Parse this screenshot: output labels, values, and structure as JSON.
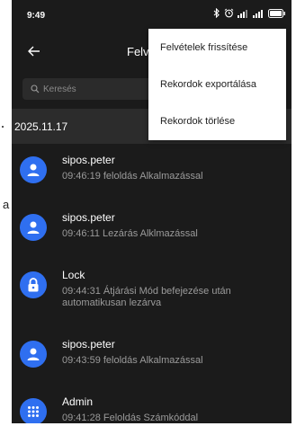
{
  "status_bar": {
    "time": "9:49",
    "icons": [
      "bluetooth-icon",
      "alarm-icon",
      "signal-icon",
      "signal-icon",
      "battery-icon"
    ]
  },
  "toolbar": {
    "title": "Felvételek",
    "back_icon": "arrow-left-icon"
  },
  "search": {
    "placeholder": "Keresés"
  },
  "date_header": "2025.11.17",
  "records": [
    {
      "name": "sipos.peter",
      "detail": "09:46:19 feloldás Alkalmazással",
      "icon": "person-icon"
    },
    {
      "name": "sipos.peter",
      "detail": "09:46:11 Lezárás Alklmazással",
      "icon": "person-icon"
    },
    {
      "name": "Lock",
      "detail": "09:44:31 Átjárási Mód befejezése után automatikusan lezárva",
      "icon": "lock-icon"
    },
    {
      "name": "sipos.peter",
      "detail": "09:43:59 feloldás Alkalmazással",
      "icon": "person-icon"
    },
    {
      "name": "Admin",
      "detail": "09:41:28 Feloldás Számkóddal",
      "icon": "keypad-icon"
    }
  ],
  "menu": {
    "items": [
      "Felvételek frissítése",
      "Rekordok exportálása",
      "Rekordok törlése"
    ]
  },
  "background_letter": "a",
  "colors": {
    "background": "#1b1b1b",
    "avatar": "#2f6ff0",
    "date_header_bg": "#2c2c2c",
    "menu_bg": "#ffffff"
  }
}
